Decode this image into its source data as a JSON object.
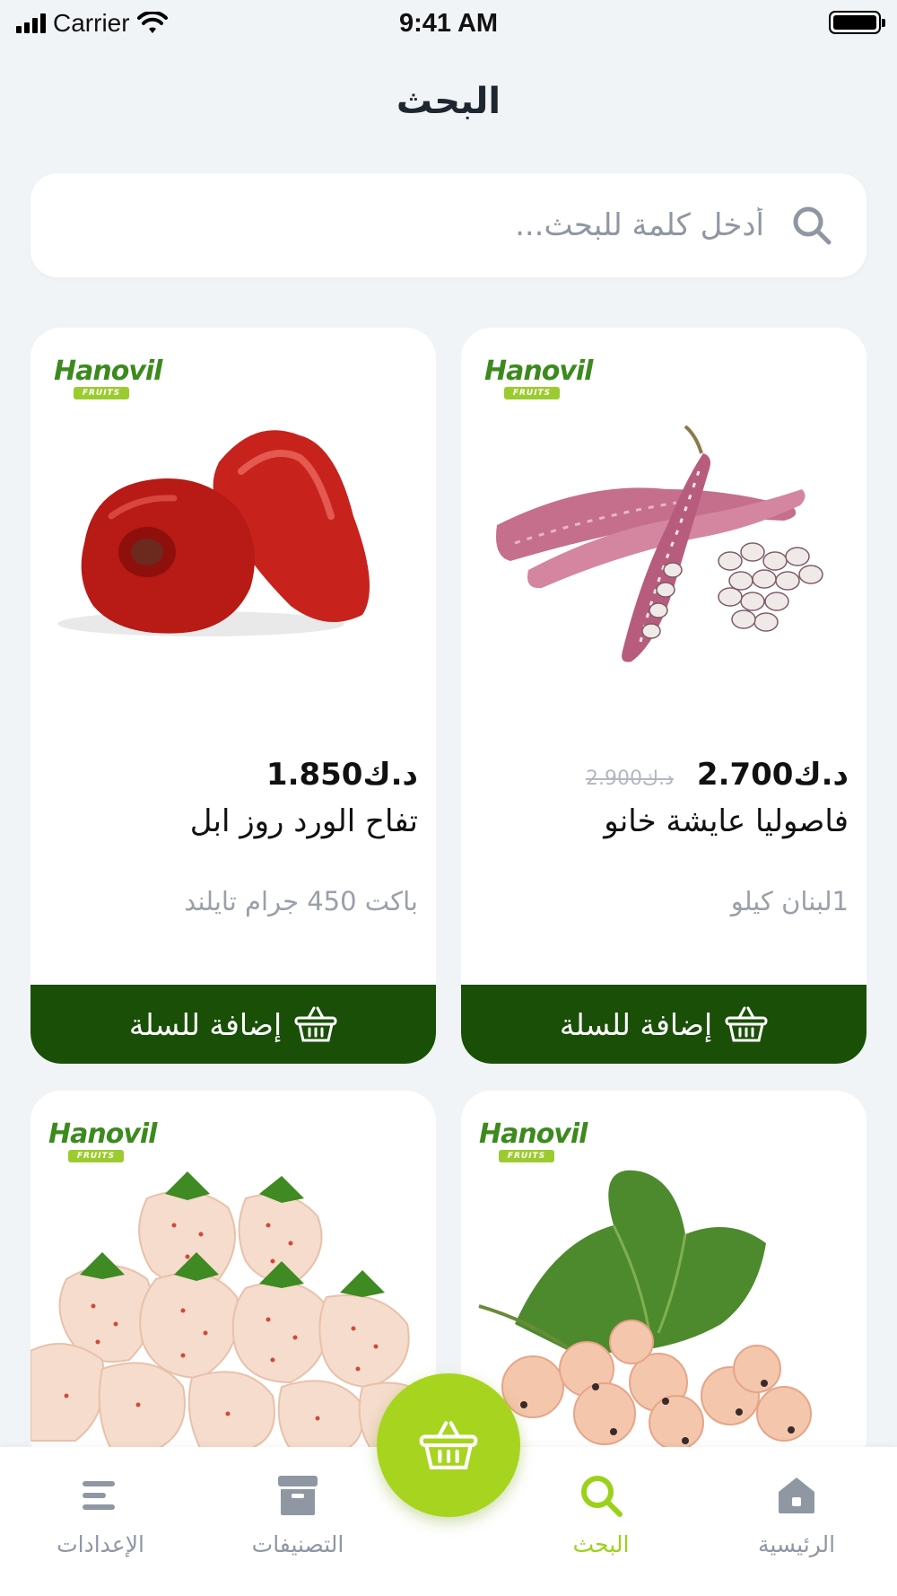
{
  "status_bar": {
    "carrier": "Carrier",
    "time": "9:41 AM"
  },
  "page": {
    "title": "البحث"
  },
  "search": {
    "placeholder": "أدخل كلمة للبحث..."
  },
  "brand": {
    "name": "Hanovil",
    "sub": "FRUITS"
  },
  "products": [
    {
      "name": "فاصوليا عايشة خانو",
      "price": "د.ك2.700",
      "old_price": "د.ك2.900",
      "subtitle": "1لبنان كيلو",
      "image": "borlotti-beans-image",
      "add_label": "إضافة للسلة"
    },
    {
      "name": "تفاح الورد روز ابل",
      "price": "د.ك1.850",
      "old_price": "",
      "subtitle": "باكت 450 جرام تايلند",
      "image": "rose-apple-image",
      "add_label": "إضافة للسلة"
    },
    {
      "name": "",
      "price": "",
      "old_price": "",
      "subtitle": "",
      "image": "white-currant-image",
      "add_label": ""
    },
    {
      "name": "",
      "price": "",
      "old_price": "",
      "subtitle": "",
      "image": "pineberry-image",
      "add_label": ""
    }
  ],
  "nav": {
    "home": "الرئيسية",
    "search": "البحث",
    "categories": "التصنيفات",
    "settings": "الإعدادات"
  },
  "colors": {
    "background": "#f1f4f7",
    "accent": "#a7d41f",
    "button": "#1a4f08",
    "muted": "#8f97a3"
  }
}
